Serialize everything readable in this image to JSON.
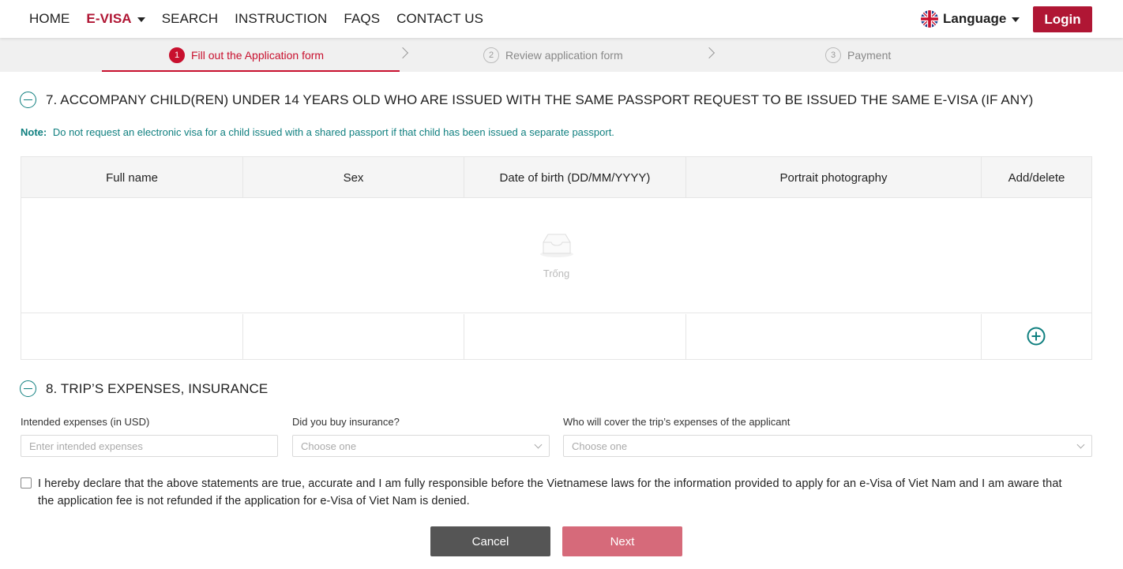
{
  "nav": {
    "items": [
      "HOME",
      "E-VISA",
      "SEARCH",
      "INSTRUCTION",
      "FAQS",
      "CONTACT US"
    ],
    "active": "E-VISA",
    "language_label": "Language",
    "login_label": "Login"
  },
  "steps": [
    {
      "num": "1",
      "label": "Fill out the Application form",
      "active": true
    },
    {
      "num": "2",
      "label": "Review application form",
      "active": false
    },
    {
      "num": "3",
      "label": "Payment",
      "active": false
    }
  ],
  "section7": {
    "title": "7. ACCOMPANY CHILD(REN) UNDER 14 YEARS OLD WHO ARE ISSUED WITH THE SAME PASSPORT REQUEST TO BE ISSUED THE SAME E-VISA (IF ANY)",
    "note_label": "Note:",
    "note_text": "Do not request an electronic visa for a child issued with a shared passport if that child has been issued a separate passport.",
    "columns": [
      "Full name",
      "Sex",
      "Date of birth (DD/MM/YYYY)",
      "Portrait photography",
      "Add/delete"
    ],
    "empty_text": "Trống"
  },
  "section8": {
    "title": "8. TRIP’S EXPENSES, INSURANCE",
    "expenses_label": "Intended expenses (in USD)",
    "expenses_placeholder": "Enter intended expenses",
    "insurance_label": "Did you buy insurance?",
    "insurance_value": "Choose one",
    "cover_label": "Who will cover the trip’s expenses of the applicant",
    "cover_value": "Choose one"
  },
  "declaration": "I hereby declare that the above statements are true, accurate and I am fully responsible before the Vietnamese laws for the information provided to apply for an e-Visa of Viet Nam and I am aware that the application fee is not refunded if the application for e-Visa of Viet Nam is denied.",
  "buttons": {
    "cancel": "Cancel",
    "next": "Next"
  },
  "colors": {
    "brand": "#b01634",
    "accent": "#0f7f7f",
    "next_button": "#d66a7a"
  }
}
